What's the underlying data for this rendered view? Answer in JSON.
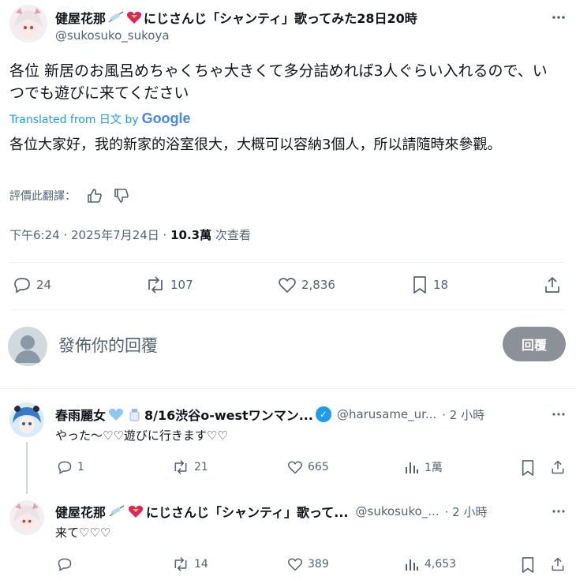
{
  "tweet": {
    "author_name": "健屋花那",
    "author_name_suffix": "にじさんじ「シャンティ」歌ってみた28日20時",
    "author_handle": "@sukosuko_sukoya",
    "text_original": "各位 新居のお風呂めちゃくちゃ大きくて多分詰めれば3人ぐらい入れるので、いつでも遊びに来てください",
    "translated_from": "Translated from 日文 by",
    "google_label": "Google",
    "text_translated": "各位大家好，我的新家的浴室很大，大概可以容納3個人，所以請隨時來參觀。",
    "rate_translation": "評價此翻譯：",
    "timestamp": "下午6:24 · 2025年7月24日 · ",
    "views_count": "10.3萬",
    "views_label": " 次查看",
    "stats": {
      "replies": "24",
      "retweets": "107",
      "likes": "2,836",
      "bookmarks": "18"
    }
  },
  "compose": {
    "placeholder": "發佈你的回覆",
    "reply_button": "回覆"
  },
  "replies": [
    {
      "author_name": "春雨麗女",
      "author_name_suffix": "8/16渋谷o-westワンマン...",
      "author_handle": "@harusame_ur...",
      "time": "· 2 小時",
      "text": "やった〜♡♡遊びに行きます♡♡",
      "stats": {
        "replies": "1",
        "retweets": "21",
        "likes": "665",
        "views": "1萬"
      }
    },
    {
      "author_name": "健屋花那",
      "author_name_suffix": "にじさんじ「シャンティ」歌って...",
      "author_handle": "@sukosuko_...",
      "time": "· 2 小時",
      "text": "来て♡♡♡",
      "stats": {
        "replies": "",
        "retweets": "14",
        "likes": "389",
        "views": "4,653"
      }
    }
  ],
  "colors": {
    "accent": "#1d9bf0",
    "text": "#0f1419",
    "muted": "#536471",
    "heart_red": "#e0245e"
  }
}
